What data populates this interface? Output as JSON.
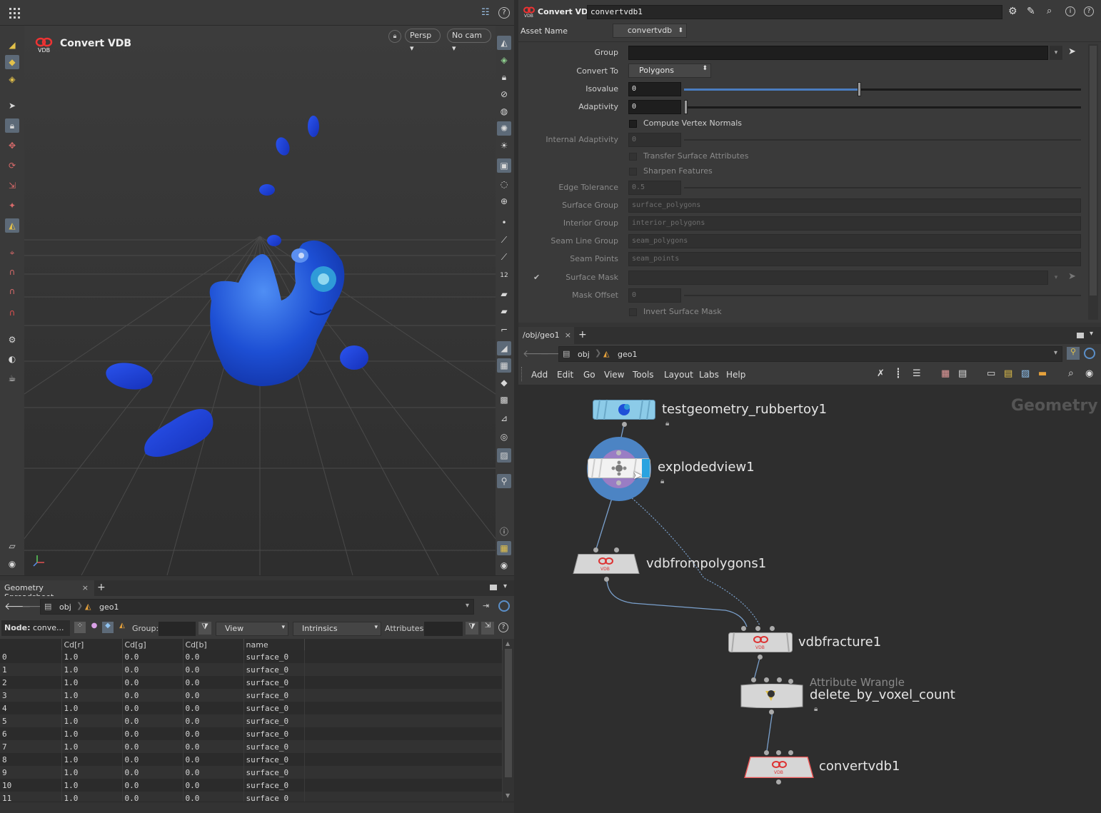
{
  "viewport": {
    "node_title": "Convert VDB",
    "persp_label": "Persp",
    "camera_label": "No cam"
  },
  "params": {
    "header_type": "Convert VDB",
    "header_name": "convertvdb1",
    "asset_name_label": "Asset Name",
    "asset_name_value": "convertvdb",
    "rows": {
      "group": {
        "label": "Group",
        "value": ""
      },
      "convert_to": {
        "label": "Convert To",
        "value": "Polygons"
      },
      "isovalue": {
        "label": "Isovalue",
        "value": "0",
        "slider": 0.44
      },
      "adaptivity": {
        "label": "Adaptivity",
        "value": "0",
        "slider": 0.0
      },
      "compute_vertex_normals": "Compute Vertex Normals",
      "internal_adaptivity": {
        "label": "Internal Adaptivity",
        "value": "0"
      },
      "transfer_surface_attributes": "Transfer Surface Attributes",
      "sharpen_features": "Sharpen Features",
      "edge_tolerance": {
        "label": "Edge Tolerance",
        "value": "0.5"
      },
      "surface_group": {
        "label": "Surface Group",
        "value": "surface_polygons"
      },
      "interior_group": {
        "label": "Interior Group",
        "value": "interior_polygons"
      },
      "seam_line_group": {
        "label": "Seam Line Group",
        "value": "seam_polygons"
      },
      "seam_points": {
        "label": "Seam Points",
        "value": "seam_points"
      },
      "surface_mask": {
        "label": "Surface Mask",
        "value": ""
      },
      "mask_offset": {
        "label": "Mask Offset",
        "value": "0"
      },
      "invert_surface_mask": "Invert Surface Mask"
    }
  },
  "network": {
    "tab_label": "/obj/geo1",
    "path": [
      "obj",
      "geo1"
    ],
    "menus": [
      "Add",
      "Edit",
      "Go",
      "View",
      "Tools",
      "Layout",
      "Labs",
      "Help"
    ],
    "context_label": "Geometry",
    "nodes": {
      "testgeometry": "testgeometry_rubbertoy1",
      "exploded": "explodedview1",
      "vdbfrompolygons": "vdbfrompolygons1",
      "vdbfracture": "vdbfracture1",
      "wrangle_type": "Attribute Wrangle",
      "wrangle_name": "delete_by_voxel_count",
      "convertvdb": "convertvdb1"
    },
    "vdb_badge": "VDB"
  },
  "spreadsheet": {
    "tab_label": "Geometry Spreadsheet",
    "path": [
      "obj",
      "geo1"
    ],
    "node_label": "Node:",
    "node_value": "conve...",
    "group_label": "Group:",
    "view_label": "View",
    "intrinsics_label": "Intrinsics",
    "attributes_label": "Attributes:",
    "columns": [
      "",
      "Cd[r]",
      "Cd[g]",
      "Cd[b]",
      "name"
    ],
    "rows": [
      [
        "0",
        "1.0",
        "0.0",
        "0.0",
        "surface_0"
      ],
      [
        "1",
        "1.0",
        "0.0",
        "0.0",
        "surface_0"
      ],
      [
        "2",
        "1.0",
        "0.0",
        "0.0",
        "surface_0"
      ],
      [
        "3",
        "1.0",
        "0.0",
        "0.0",
        "surface_0"
      ],
      [
        "4",
        "1.0",
        "0.0",
        "0.0",
        "surface_0"
      ],
      [
        "5",
        "1.0",
        "0.0",
        "0.0",
        "surface_0"
      ],
      [
        "6",
        "1.0",
        "0.0",
        "0.0",
        "surface_0"
      ],
      [
        "7",
        "1.0",
        "0.0",
        "0.0",
        "surface_0"
      ],
      [
        "8",
        "1.0",
        "0.0",
        "0.0",
        "surface_0"
      ],
      [
        "9",
        "1.0",
        "0.0",
        "0.0",
        "surface_0"
      ],
      [
        "10",
        "1.0",
        "0.0",
        "0.0",
        "surface_0"
      ],
      [
        "11",
        "1.0",
        "0.0",
        "0.0",
        "surface_0"
      ]
    ]
  },
  "colors": {
    "toy_blue": "#1f4fd8",
    "selected_node": "#4c84c4",
    "node_flag_blue": "#29a3e0",
    "testgeo_node": "#8ccbe8"
  }
}
